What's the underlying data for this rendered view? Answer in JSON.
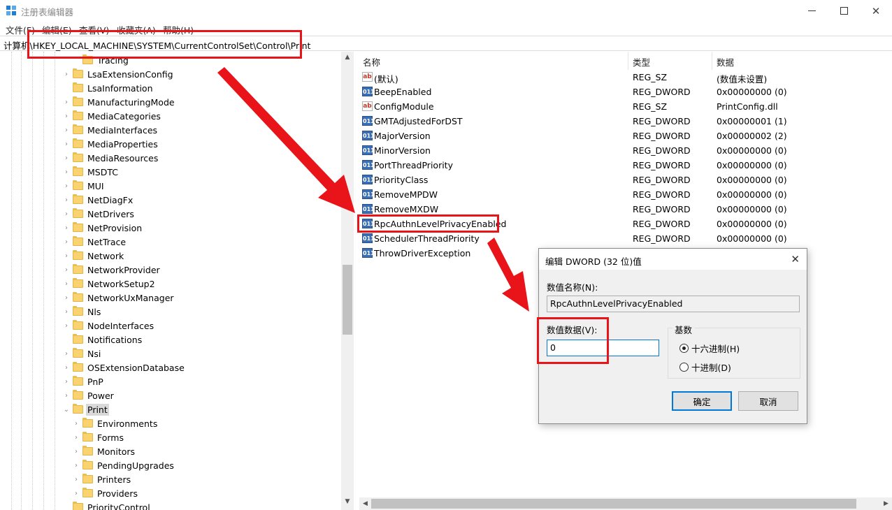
{
  "window": {
    "title": "注册表编辑器"
  },
  "menu": [
    "文件(F)",
    "编辑(E)",
    "查看(V)",
    "收藏夹(A)",
    "帮助(H)"
  ],
  "address": "计算机\\HKEY_LOCAL_MACHINE\\SYSTEM\\CurrentControlSet\\Control\\Print",
  "tree": {
    "items": [
      {
        "label": "Tracing",
        "depth": 1,
        "expandable": false
      },
      {
        "label": "LsaExtensionConfig",
        "depth": 0,
        "expandable": true
      },
      {
        "label": "LsaInformation",
        "depth": 0,
        "expandable": false
      },
      {
        "label": "ManufacturingMode",
        "depth": 0,
        "expandable": true
      },
      {
        "label": "MediaCategories",
        "depth": 0,
        "expandable": true
      },
      {
        "label": "MediaInterfaces",
        "depth": 0,
        "expandable": true
      },
      {
        "label": "MediaProperties",
        "depth": 0,
        "expandable": true
      },
      {
        "label": "MediaResources",
        "depth": 0,
        "expandable": true
      },
      {
        "label": "MSDTC",
        "depth": 0,
        "expandable": true
      },
      {
        "label": "MUI",
        "depth": 0,
        "expandable": true
      },
      {
        "label": "NetDiagFx",
        "depth": 0,
        "expandable": true
      },
      {
        "label": "NetDrivers",
        "depth": 0,
        "expandable": true
      },
      {
        "label": "NetProvision",
        "depth": 0,
        "expandable": true
      },
      {
        "label": "NetTrace",
        "depth": 0,
        "expandable": true
      },
      {
        "label": "Network",
        "depth": 0,
        "expandable": true
      },
      {
        "label": "NetworkProvider",
        "depth": 0,
        "expandable": true
      },
      {
        "label": "NetworkSetup2",
        "depth": 0,
        "expandable": true
      },
      {
        "label": "NetworkUxManager",
        "depth": 0,
        "expandable": true
      },
      {
        "label": "Nls",
        "depth": 0,
        "expandable": true
      },
      {
        "label": "NodeInterfaces",
        "depth": 0,
        "expandable": true
      },
      {
        "label": "Notifications",
        "depth": 0,
        "expandable": false
      },
      {
        "label": "Nsi",
        "depth": 0,
        "expandable": true
      },
      {
        "label": "OSExtensionDatabase",
        "depth": 0,
        "expandable": true
      },
      {
        "label": "PnP",
        "depth": 0,
        "expandable": true
      },
      {
        "label": "Power",
        "depth": 0,
        "expandable": true
      },
      {
        "label": "Print",
        "depth": 0,
        "expandable": true,
        "expanded": true,
        "selected": true
      },
      {
        "label": "Environments",
        "depth": 1,
        "expandable": true
      },
      {
        "label": "Forms",
        "depth": 1,
        "expandable": true
      },
      {
        "label": "Monitors",
        "depth": 1,
        "expandable": true
      },
      {
        "label": "PendingUpgrades",
        "depth": 1,
        "expandable": true
      },
      {
        "label": "Printers",
        "depth": 1,
        "expandable": true
      },
      {
        "label": "Providers",
        "depth": 1,
        "expandable": true
      },
      {
        "label": "PriorityControl",
        "depth": 0,
        "expandable": false
      }
    ]
  },
  "list": {
    "headers": {
      "name": "名称",
      "type": "类型",
      "data": "数据"
    },
    "rows": [
      {
        "name": "(默认)",
        "type": "REG_SZ",
        "data": "(数值未设置)",
        "icon": "sz"
      },
      {
        "name": "BeepEnabled",
        "type": "REG_DWORD",
        "data": "0x00000000 (0)",
        "icon": "dword"
      },
      {
        "name": "ConfigModule",
        "type": "REG_SZ",
        "data": "PrintConfig.dll",
        "icon": "sz"
      },
      {
        "name": "GMTAdjustedForDST",
        "type": "REG_DWORD",
        "data": "0x00000001 (1)",
        "icon": "dword"
      },
      {
        "name": "MajorVersion",
        "type": "REG_DWORD",
        "data": "0x00000002 (2)",
        "icon": "dword"
      },
      {
        "name": "MinorVersion",
        "type": "REG_DWORD",
        "data": "0x00000000 (0)",
        "icon": "dword"
      },
      {
        "name": "PortThreadPriority",
        "type": "REG_DWORD",
        "data": "0x00000000 (0)",
        "icon": "dword"
      },
      {
        "name": "PriorityClass",
        "type": "REG_DWORD",
        "data": "0x00000000 (0)",
        "icon": "dword"
      },
      {
        "name": "RemoveMPDW",
        "type": "REG_DWORD",
        "data": "0x00000000 (0)",
        "icon": "dword"
      },
      {
        "name": "RemoveMXDW",
        "type": "REG_DWORD",
        "data": "0x00000000 (0)",
        "icon": "dword"
      },
      {
        "name": "RpcAuthnLevelPrivacyEnabled",
        "type": "REG_DWORD",
        "data": "0x00000000 (0)",
        "icon": "dword"
      },
      {
        "name": "SchedulerThreadPriority",
        "type": "REG_DWORD",
        "data": "0x00000000 (0)",
        "icon": "dword"
      },
      {
        "name": "ThrowDriverException",
        "type": "",
        "data": "",
        "icon": "dword"
      }
    ]
  },
  "dialog": {
    "title": "编辑 DWORD (32 位)值",
    "name_label": "数值名称(N):",
    "name_value": "RpcAuthnLevelPrivacyEnabled",
    "data_label": "数值数据(V):",
    "data_value": "0",
    "base_label": "基数",
    "radio_hex": "十六进制(H)",
    "radio_dec": "十进制(D)",
    "selected_base": "hex",
    "ok": "确定",
    "cancel": "取消"
  },
  "colors": {
    "highlight": "#e8141a",
    "folder": "#f9d36f",
    "accent": "#0078d7"
  }
}
